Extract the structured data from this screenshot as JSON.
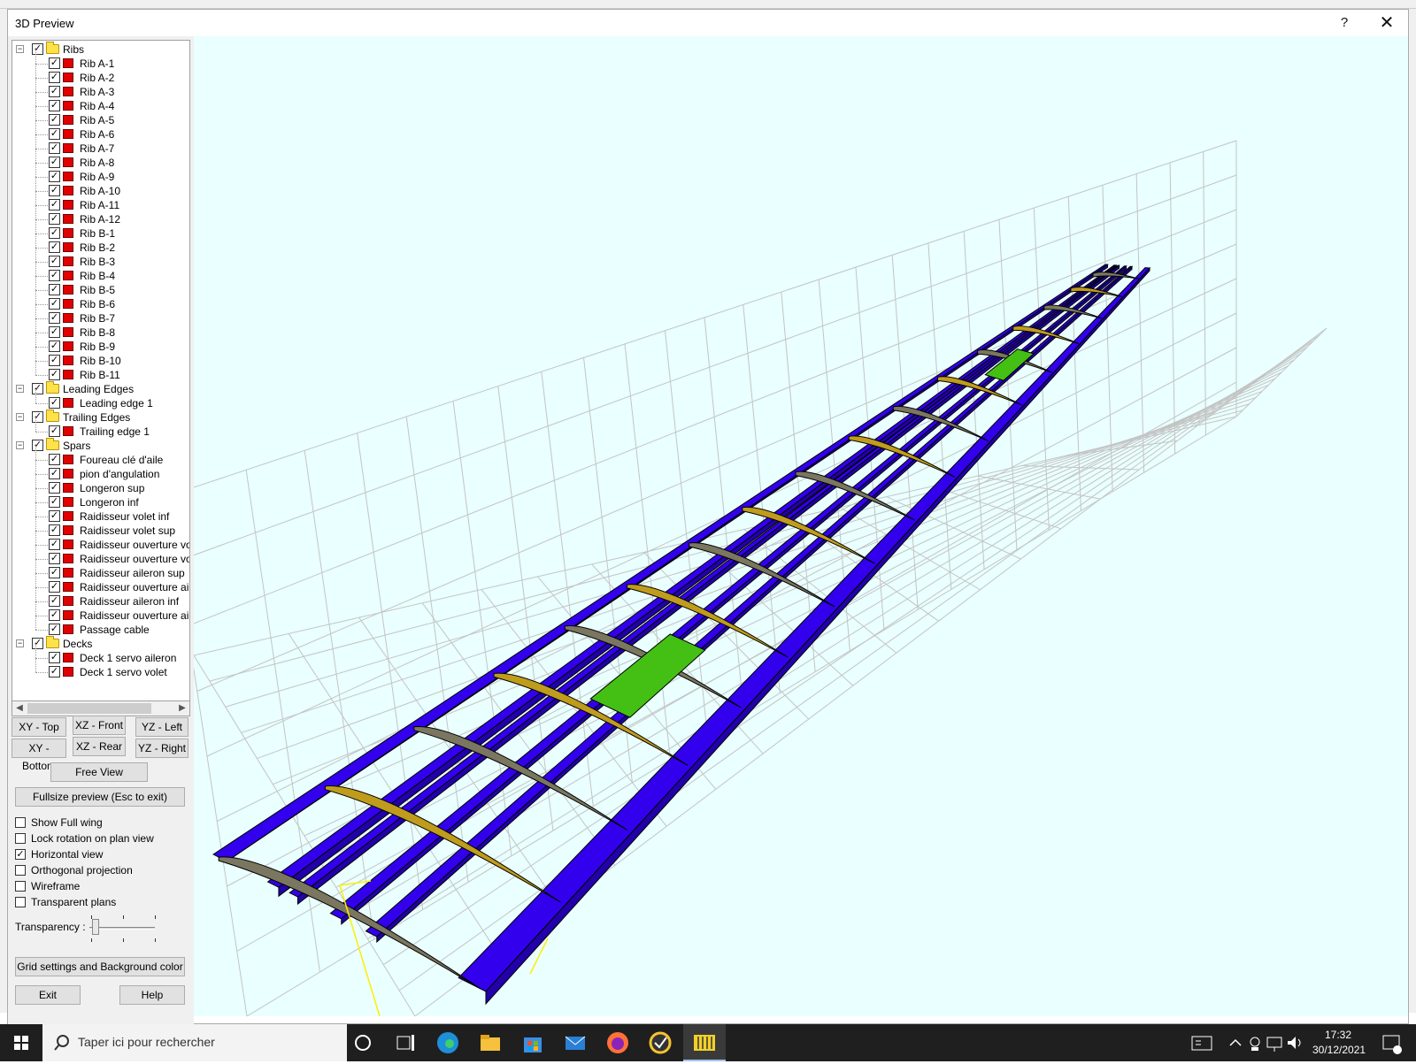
{
  "window": {
    "title": "3D Preview",
    "help_glyph": "?",
    "close_glyph": "✕"
  },
  "tree": {
    "groups": [
      {
        "label": "Ribs",
        "items": [
          "Rib A-1",
          "Rib A-2",
          "Rib A-3",
          "Rib A-4",
          "Rib A-5",
          "Rib A-6",
          "Rib A-7",
          "Rib A-8",
          "Rib A-9",
          "Rib A-10",
          "Rib A-11",
          "Rib A-12",
          "Rib B-1",
          "Rib B-2",
          "Rib B-3",
          "Rib B-4",
          "Rib B-5",
          "Rib B-6",
          "Rib B-7",
          "Rib B-8",
          "Rib B-9",
          "Rib B-10",
          "Rib B-11"
        ]
      },
      {
        "label": "Leading Edges",
        "items": [
          "Leading edge 1"
        ]
      },
      {
        "label": "Trailing Edges",
        "items": [
          "Trailing edge 1"
        ]
      },
      {
        "label": "Spars",
        "items": [
          "Foureau clé d'aile",
          "pion d'angulation",
          "Longeron sup",
          "Longeron inf",
          "Raidisseur volet inf",
          "Raidisseur volet sup",
          "Raidisseur ouverture volet",
          "Raidisseur ouverture volet",
          "Raidisseur aileron sup",
          "Raidisseur ouverture ailerc",
          "Raidisseur aileron inf",
          "Raidisseur ouverture ailerc",
          "Passage cable"
        ]
      },
      {
        "label": "Decks",
        "items": [
          "Deck 1 servo aileron",
          "Deck 1 servo volet"
        ]
      }
    ]
  },
  "view_buttons": {
    "xy_top": "XY - Top",
    "xz_front": "XZ - Front",
    "yz_left": "YZ - Left",
    "xy_bottom": "XY - Bottom",
    "xz_rear": "XZ - Rear",
    "yz_right": "YZ - Right",
    "free_view": "Free View",
    "fullsize": "Fullsize preview (Esc to exit)"
  },
  "options": [
    {
      "label": "Show Full wing",
      "checked": false
    },
    {
      "label": "Lock rotation on plan view",
      "checked": false
    },
    {
      "label": "Horizontal view",
      "checked": true
    },
    {
      "label": "Orthogonal projection",
      "checked": false
    },
    {
      "label": "Wireframe",
      "checked": false
    },
    {
      "label": "Transparent plans",
      "checked": false
    }
  ],
  "transparency": {
    "label": "Transparency :",
    "value": 0.1
  },
  "bottom_buttons": {
    "grid": "Grid settings and Background color",
    "exit": "Exit",
    "help": "Help"
  },
  "colors": {
    "viewport_bg": "#eaffff",
    "spar": "#3300ee",
    "rib_tan": "#c09c1c",
    "rib_gray": "#7a7660",
    "deck": "#44c014"
  },
  "taskbar": {
    "search_placeholder": "Taper ici pour rechercher",
    "time": "17:32",
    "date": "30/12/2021"
  }
}
